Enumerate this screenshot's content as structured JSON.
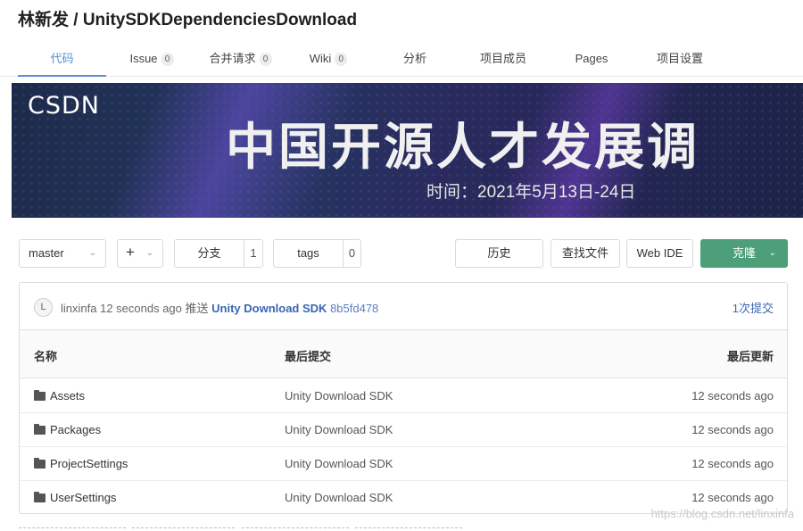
{
  "repo": {
    "title": "林新发 / UnitySDKDependenciesDownload"
  },
  "tabs": [
    {
      "label": "代码"
    },
    {
      "label": "Issue",
      "count": "0"
    },
    {
      "label": "合并请求",
      "count": "0"
    },
    {
      "label": "Wiki",
      "count": "0"
    },
    {
      "label": "分析"
    },
    {
      "label": "项目成员"
    },
    {
      "label": "Pages"
    },
    {
      "label": "项目设置"
    }
  ],
  "banner": {
    "logo": "CSDN",
    "headline": "中国开源人才发展调",
    "dates": "时间：2021年5月13日-24日"
  },
  "toolbar": {
    "branch": "master",
    "add_symbol": "+",
    "branches_label": "分支",
    "branches_count": "1",
    "tags_label": "tags",
    "tags_count": "0",
    "history": "历史",
    "find_file": "查找文件",
    "web_ide": "Web IDE",
    "clone": "克隆"
  },
  "commit": {
    "avatar_letter": "L",
    "author": "linxinfa",
    "time": "12 seconds ago",
    "action": "推送",
    "message": "Unity Download SDK",
    "hash": "8b5fd478",
    "commits_link": "1次提交"
  },
  "table": {
    "headers": {
      "name": "名称",
      "last_commit": "最后提交",
      "last_update": "最后更新"
    },
    "rows": [
      {
        "name": "Assets",
        "commit": "Unity Download SDK",
        "updated": "12 seconds ago"
      },
      {
        "name": "Packages",
        "commit": "Unity Download SDK",
        "updated": "12 seconds ago"
      },
      {
        "name": "ProjectSettings",
        "commit": "Unity Download SDK",
        "updated": "12 seconds ago"
      },
      {
        "name": "UserSettings",
        "commit": "Unity Download SDK",
        "updated": "12 seconds ago"
      }
    ]
  },
  "watermark": "https://blog.csdn.net/linxinfa",
  "colors": {
    "accent": "#5a8fd6",
    "clone_button": "#4c9f78",
    "link": "#3a66b3"
  }
}
